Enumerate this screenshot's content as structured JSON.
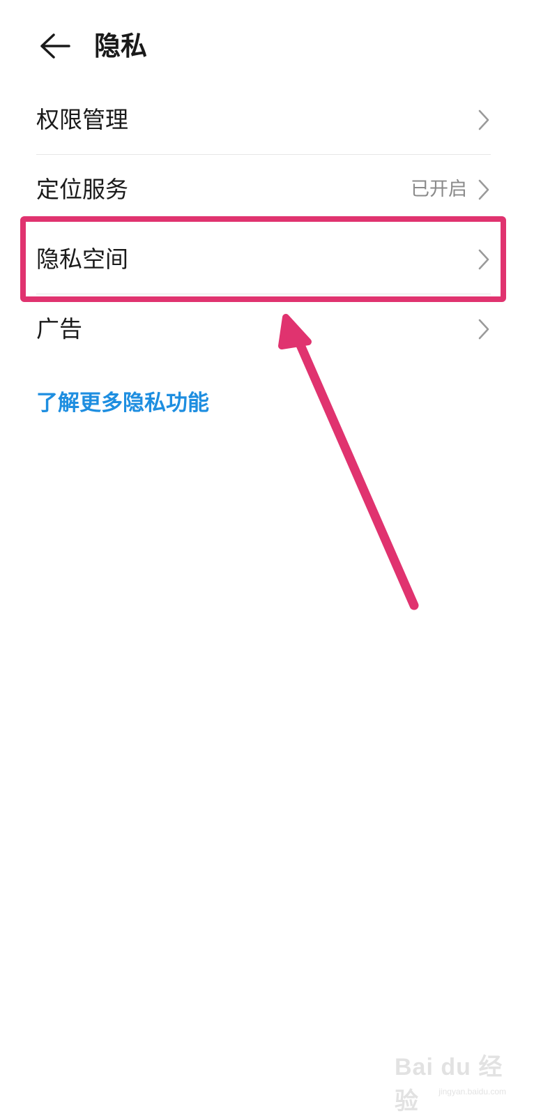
{
  "header": {
    "back_icon": "arrow-left-icon",
    "title": "隐私"
  },
  "list": [
    {
      "label": "权限管理",
      "value": "",
      "chevron": "chevron-right-icon"
    },
    {
      "label": "定位服务",
      "value": "已开启",
      "chevron": "chevron-right-icon"
    },
    {
      "label": "隐私空间",
      "value": "",
      "chevron": "chevron-right-icon"
    },
    {
      "label": "广告",
      "value": "",
      "chevron": "chevron-right-icon"
    }
  ],
  "learn_more": "了解更多隐私功能",
  "annotation": {
    "highlight_color": "#e0336f",
    "highlighted_item": "隐私空间"
  },
  "colors": {
    "link": "#1e8ee0",
    "text": "#1a1a1a",
    "secondary_text": "#8a8a8a",
    "divider": "#e6e6e6"
  },
  "watermark": {
    "logo": "Bai du 经验",
    "url": "jingyan.baidu.com"
  }
}
